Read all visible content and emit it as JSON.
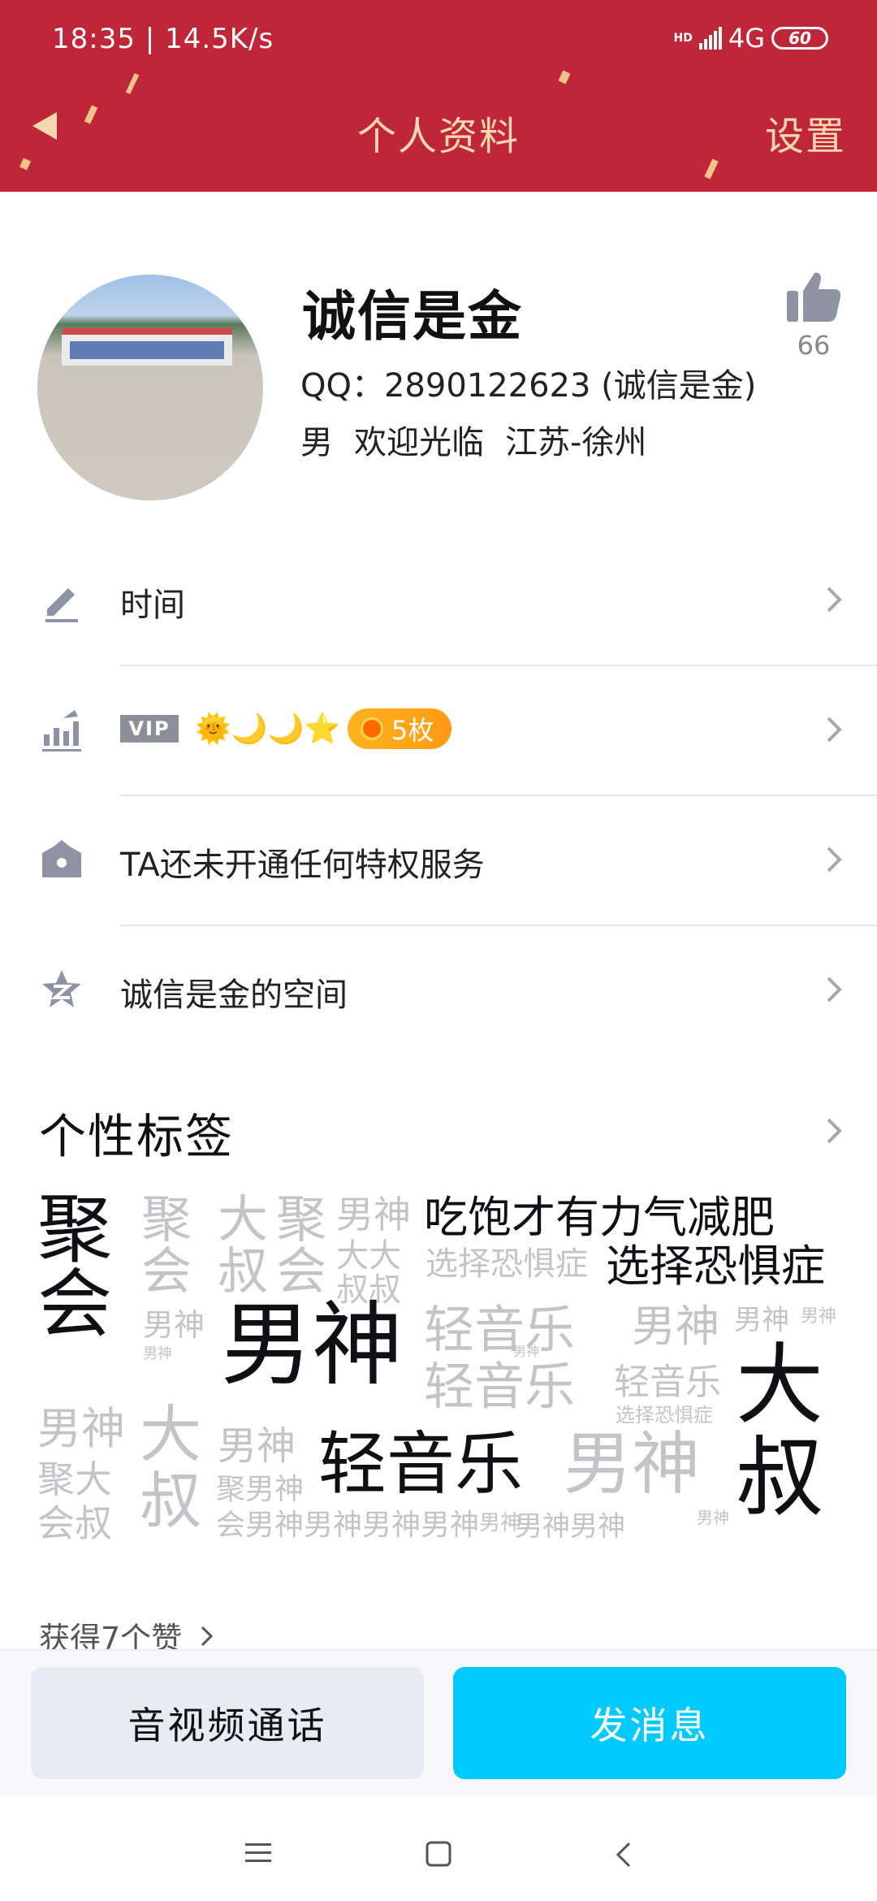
{
  "status_bar": {
    "time": "18:35",
    "speed": "14.5K/s",
    "hd": "HD",
    "network": "4G",
    "battery": "60"
  },
  "nav": {
    "title": "个人资料",
    "settings_label": "设置"
  },
  "profile": {
    "name": "诚信是金",
    "qq_line": "QQ：2890122623 (诚信是金)",
    "gender": "男",
    "greeting": "欢迎光临",
    "location": "江苏-徐州",
    "like_count": "66"
  },
  "rows": {
    "signature": "时间",
    "vip_label": "VIP",
    "level_icons": "🌞🌙🌙⭐",
    "medal_badge": "5枚",
    "privilege": "TA还未开通任何特权服务",
    "space": "诚信是金的空间"
  },
  "tags": {
    "title": "个性标签",
    "words": {
      "w1": "聚",
      "w2": "会",
      "w3": "聚",
      "w4": "会",
      "w5": "大",
      "w6": "叔",
      "w7": "聚",
      "w8": "会",
      "w9": "男神",
      "w10": "吃饱才有力气减肥",
      "w11": "大大",
      "w12": "叔叔",
      "w13": "选择恐惧症",
      "w14": "选择恐惧症",
      "w15": "男神",
      "w16": "男神",
      "w17": "男神",
      "w18": "轻音乐",
      "w19": "男神",
      "w20": "男神",
      "w21": "男神",
      "w22": "轻音乐",
      "w23": "轻音乐",
      "w24": "大",
      "w25": "叔",
      "w26": "男神",
      "w27": "大",
      "w28": "叔",
      "w29": "聚大",
      "w30": "会叔",
      "w31": "男神",
      "w32": "聚男神",
      "w33": "会男神男神男神男神",
      "w34": "轻音乐",
      "w35": "男神",
      "w36": "男神男神",
      "w37": "选择恐惧症",
      "w38": "男神",
      "w39": "男神",
      "w40": "男神"
    }
  },
  "likes_summary": "获得7个赞",
  "actions": {
    "call": "音视频通话",
    "message": "发消息"
  }
}
